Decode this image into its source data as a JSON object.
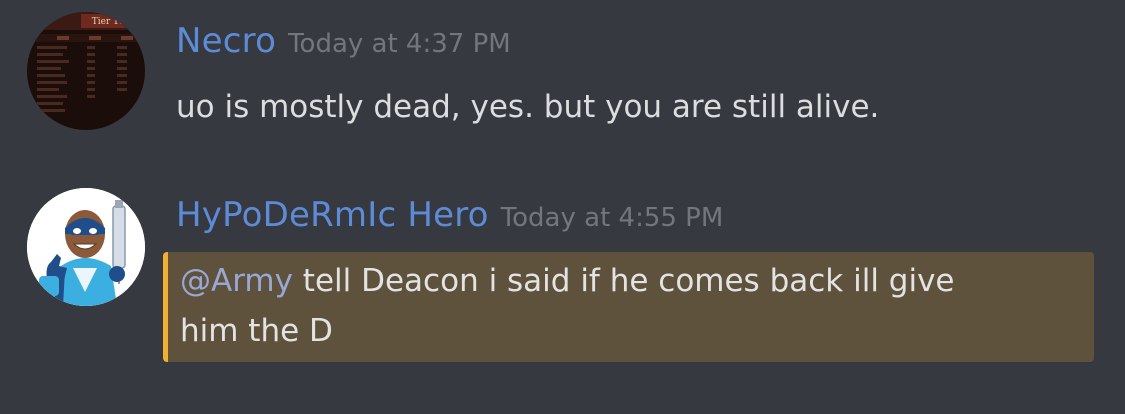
{
  "messages": [
    {
      "username": "Necro",
      "timestamp": "Today at 4:37 PM",
      "text": "uo is mostly dead, yes.  but you are still alive.",
      "avatar_label": "Tier 105",
      "name_color": "#5e8bd6"
    },
    {
      "username": "HyPoDeRmIc Hero",
      "timestamp": "Today at 4:55 PM",
      "mention": "@Army",
      "text_line1": " tell Deacon i said if he comes back ill give",
      "text_line2": "him the D",
      "name_color": "#5e8bd6",
      "highlight_color": "#5e523c",
      "highlight_border": "#f0b132"
    }
  ],
  "colors": {
    "background": "#36393f",
    "text": "#dcddde",
    "timestamp": "#72767d",
    "mention": "#99a7d4"
  }
}
